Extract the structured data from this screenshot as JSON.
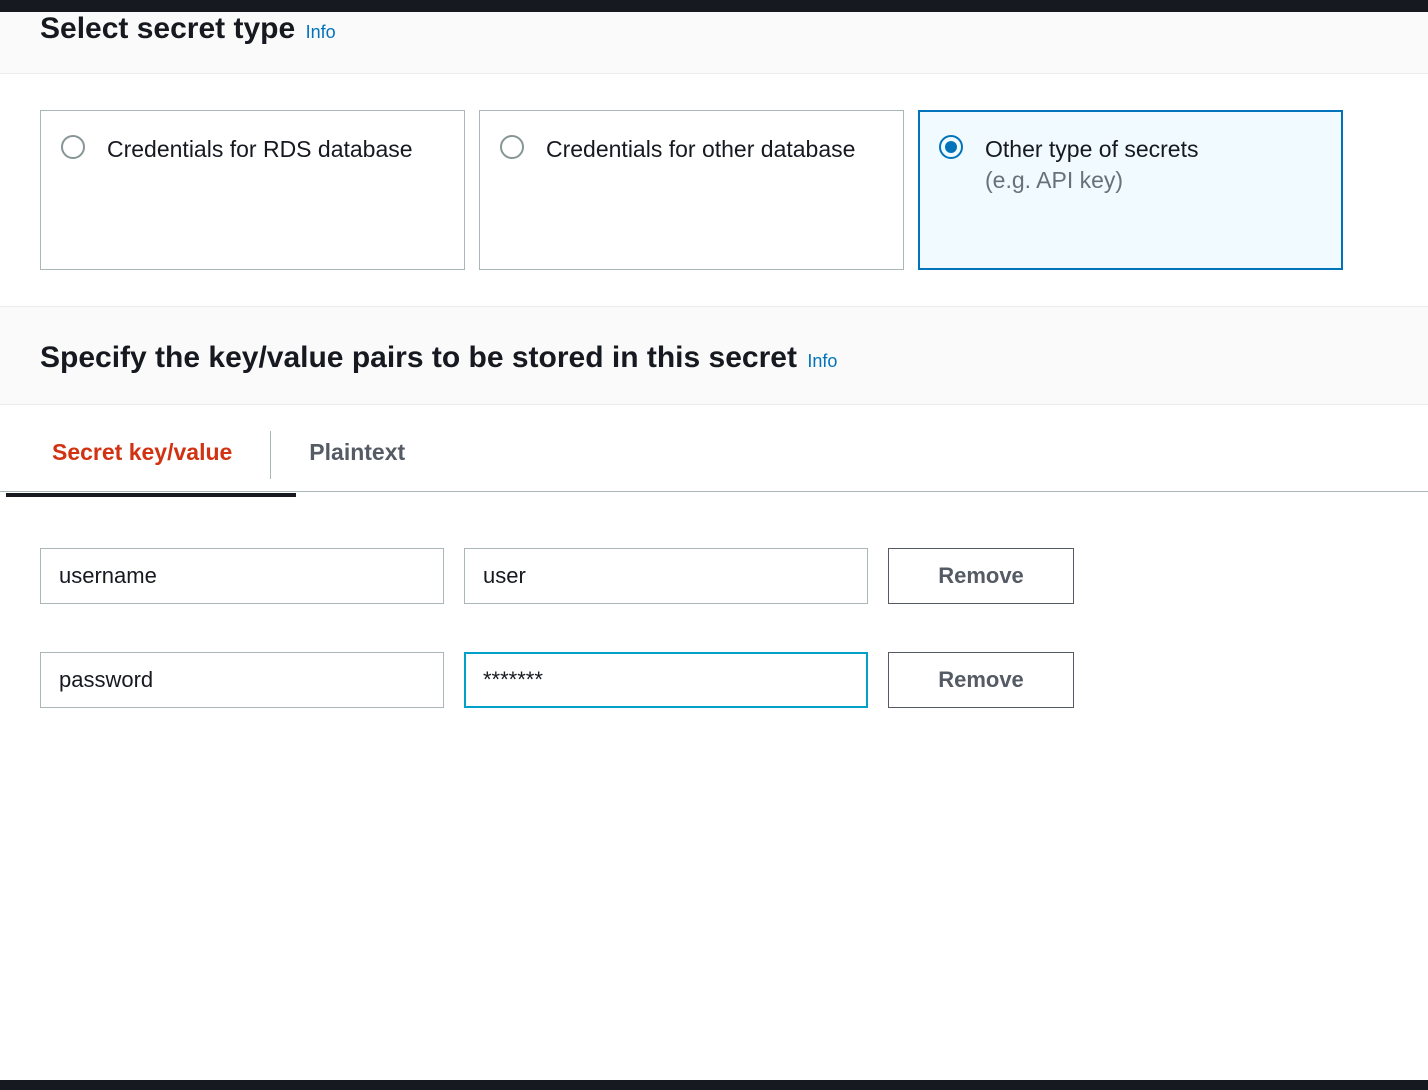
{
  "section1": {
    "title": "Select secret type",
    "info": "Info"
  },
  "options": [
    {
      "label": "Credentials for RDS database",
      "sublabel": "",
      "selected": false
    },
    {
      "label": "Credentials for other database",
      "sublabel": "",
      "selected": false
    },
    {
      "label": "Other type of secrets",
      "sublabel": "(e.g. API key)",
      "selected": true
    }
  ],
  "section2": {
    "title": "Specify the key/value pairs to be stored in this secret",
    "info": "Info"
  },
  "tabs": {
    "active": "Secret key/value",
    "inactive": "Plaintext"
  },
  "rows": [
    {
      "key": "username",
      "value": "user",
      "remove": "Remove",
      "focused": false
    },
    {
      "key": "password",
      "value": "*******",
      "remove": "Remove",
      "focused": true
    }
  ]
}
